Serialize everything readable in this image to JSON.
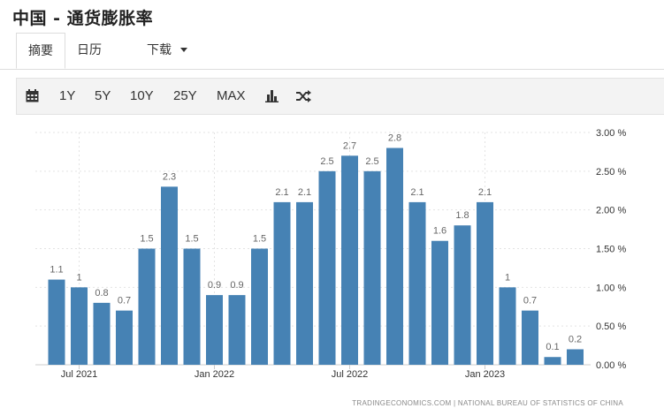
{
  "page": {
    "title": "中国 - 通货膨胀率"
  },
  "tabs": [
    {
      "label": "摘要",
      "active": true
    },
    {
      "label": "日历",
      "active": false
    },
    {
      "label": "下载",
      "active": false
    }
  ],
  "toolbar": {
    "items": [
      "1Y",
      "5Y",
      "10Y",
      "25Y",
      "MAX"
    ],
    "icons": [
      "calendar-icon",
      "bar-chart-icon",
      "shuffle-icon"
    ]
  },
  "colors": {
    "bar": "#4682b4",
    "toolbar_bg": "#f3f3f3"
  },
  "source": "TRADINGECONOMICS.COM | NATIONAL BUREAU OF STATISTICS OF CHINA",
  "chart_data": {
    "type": "bar",
    "categories": [
      "2021-06",
      "2021-07",
      "2021-08",
      "2021-09",
      "2021-10",
      "2021-11",
      "2021-12",
      "2022-01",
      "2022-02",
      "2022-03",
      "2022-04",
      "2022-05",
      "2022-06",
      "2022-07",
      "2022-08",
      "2022-09",
      "2022-10",
      "2022-11",
      "2022-12",
      "2023-01",
      "2023-02",
      "2023-03",
      "2023-04",
      "2023-05"
    ],
    "values": [
      1.1,
      1,
      0.8,
      0.7,
      1.5,
      2.3,
      1.5,
      0.9,
      0.9,
      1.5,
      2.1,
      2.1,
      2.5,
      2.7,
      2.5,
      2.8,
      2.1,
      1.6,
      1.8,
      2.1,
      1,
      0.7,
      0.1,
      0.2
    ],
    "data_labels": [
      "1.1",
      "1",
      "0.8",
      "0.7",
      "1.5",
      "2.3",
      "1.5",
      "0.9",
      "0.9",
      "1.5",
      "2.1",
      "2.1",
      "2.5",
      "2.7",
      "2.5",
      "2.8",
      "2.1",
      "1.6",
      "1.8",
      "2.1",
      "1",
      "0.7",
      "0.1",
      "0.2"
    ],
    "x_ticks": [
      {
        "index": 1,
        "label": "Jul 2021"
      },
      {
        "index": 7,
        "label": "Jan 2022"
      },
      {
        "index": 13,
        "label": "Jul 2022"
      },
      {
        "index": 19,
        "label": "Jan 2023"
      }
    ],
    "y_ticks": [
      "3.00 %",
      "2.50 %",
      "2.00 %",
      "1.50 %",
      "1.00 %",
      "0.50 %",
      "0.00 %"
    ],
    "ylim": [
      0,
      3
    ],
    "grid": true
  }
}
